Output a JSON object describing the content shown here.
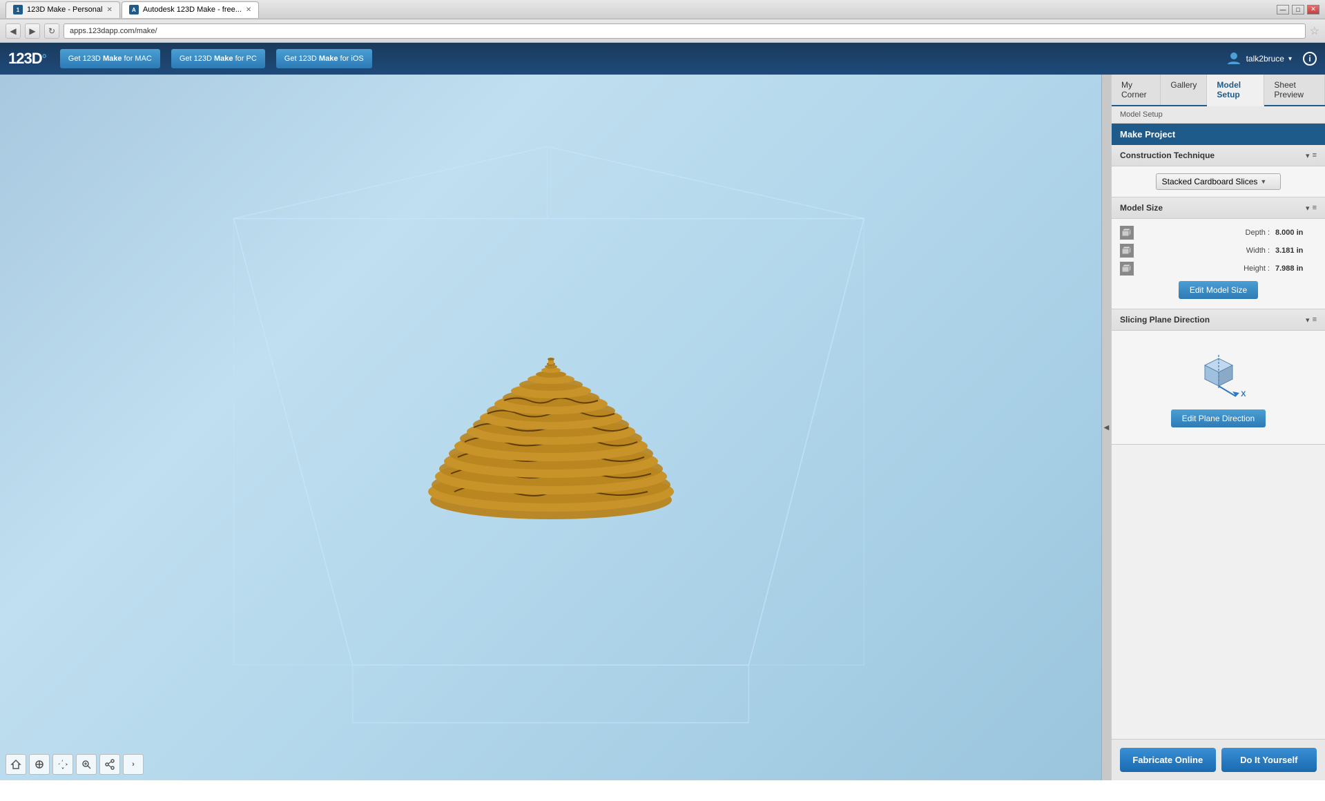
{
  "browser": {
    "titlebar": {
      "tab1_label": "123D Make - Personal",
      "tab2_label": "Autodesk 123D Make - free...",
      "tab2_active": true
    },
    "navbar": {
      "back": "◀",
      "forward": "▶",
      "refresh": "↻",
      "url": "apps.123dapp.com/make/",
      "star": "☆"
    }
  },
  "app_header": {
    "logo": "123D",
    "logo_symbol": "°",
    "btn_mac_label": "Get 123D Make for MAC",
    "btn_mac_make": "Make",
    "btn_pc_label": "Get 123D Make for PC",
    "btn_pc_make": "Make",
    "btn_ios_label": "Get 123D Make for iOS",
    "btn_ios_make": "Make",
    "user_label": "talk2bruce",
    "info": "i"
  },
  "panel": {
    "tabs": [
      {
        "id": "my-corner",
        "label": "My Corner"
      },
      {
        "id": "gallery",
        "label": "Gallery"
      },
      {
        "id": "model-setup",
        "label": "Model Setup",
        "active": true
      },
      {
        "id": "sheet-preview",
        "label": "Sheet Preview"
      }
    ],
    "breadcrumb": "Model Setup",
    "title": "Make Project",
    "construction_section": {
      "title": "Construction Technique",
      "technique_value": "Stacked Cardboard Slices",
      "dropdown_arrow": "▼"
    },
    "model_size_section": {
      "title": "Model Size",
      "depth_label": "Depth :",
      "depth_value": "8.000 in",
      "width_label": "Width :",
      "width_value": "3.181 in",
      "height_label": "Height :",
      "height_value": "7.988 in",
      "edit_btn": "Edit Model Size"
    },
    "slicing_section": {
      "title": "Slicing Plane Direction",
      "edit_btn": "Edit Plane Direction",
      "axis_x": "X"
    },
    "footer": {
      "fabricate_btn": "Fabricate Online",
      "diy_btn": "Do It Yourself"
    }
  },
  "viewport": {
    "tools": [
      "🏠",
      "✥",
      "✋",
      "⊕",
      "↗"
    ]
  },
  "colors": {
    "header_bg": "#1a3a5c",
    "accent_blue": "#1e5a8a",
    "btn_blue": "#2e7ab5",
    "viewport_bg1": "#a8c8e0",
    "viewport_bg2": "#c0dff0",
    "cardboard": "#c8942a",
    "cardboard_shadow": "#8a6010"
  }
}
